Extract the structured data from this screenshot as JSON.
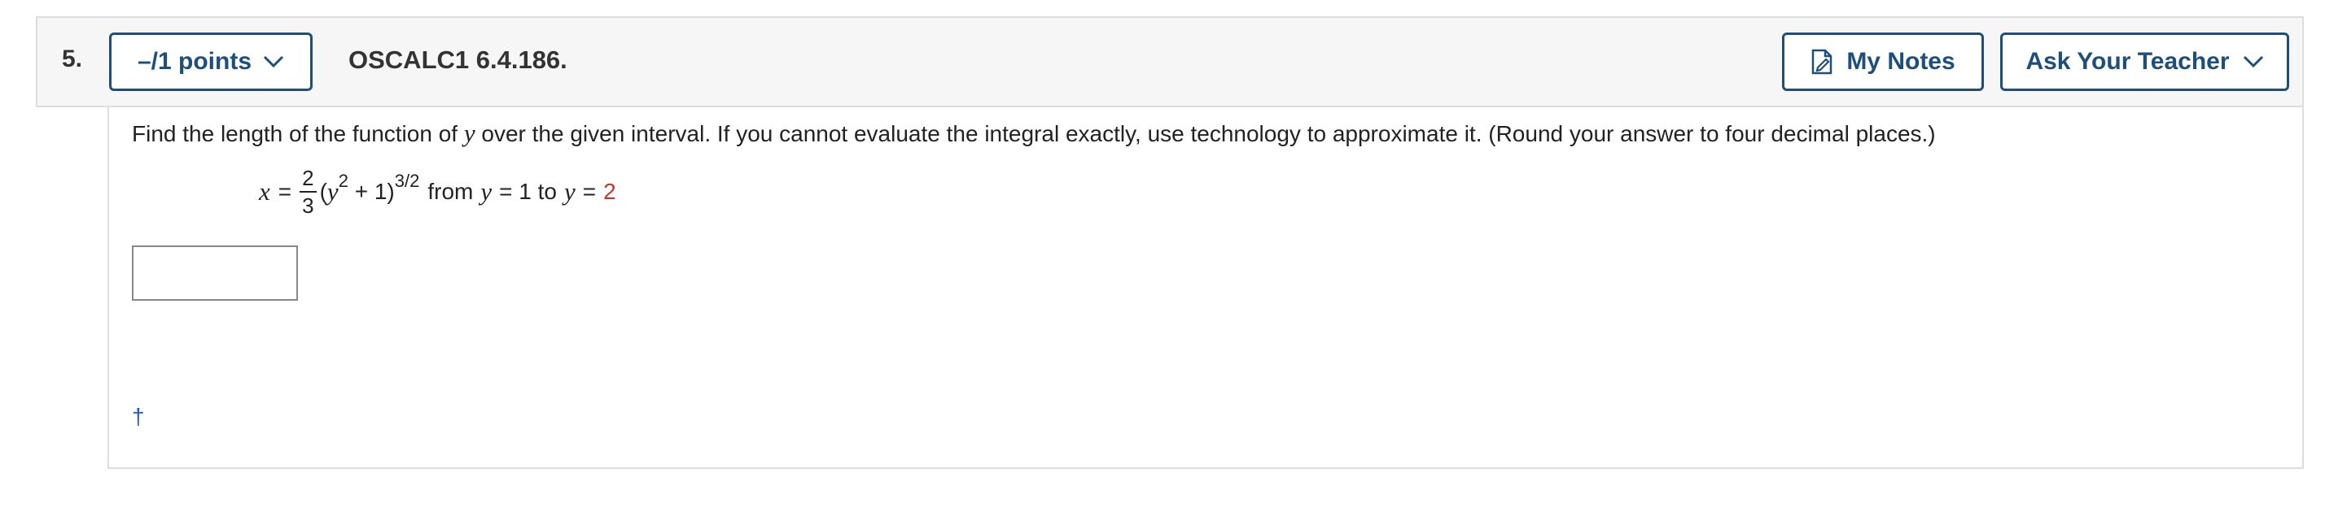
{
  "question": {
    "number": "5.",
    "points_label": "–/1 points",
    "code": "OSCALC1 6.4.186."
  },
  "header_buttons": {
    "my_notes": "My Notes",
    "ask_teacher": "Ask Your Teacher"
  },
  "prompt": {
    "text_1": "Find the length of the function of ",
    "var": "y",
    "text_2": " over the given interval. If you cannot evaluate the integral exactly, use technology to approximate it. (Round your answer to four decimal places.)"
  },
  "equation": {
    "lhs_var": "x",
    "equals": "=",
    "frac_num": "2",
    "frac_den": "3",
    "open": "(",
    "inner_var": "y",
    "inner_exp": "2",
    "inner_rest": " + 1)",
    "outer_exp": "3/2",
    "from": "from",
    "var1": "y",
    "eq1": "= 1 to",
    "var2": "y",
    "eq2": "=",
    "upper": "2"
  },
  "answer": {
    "value": ""
  },
  "footnote": {
    "dagger": "†"
  },
  "colors": {
    "accent": "#1e4f7a",
    "highlight": "#c0392b",
    "link": "#2255cc"
  },
  "icons": [
    "chevron-down-icon",
    "notes-icon"
  ]
}
